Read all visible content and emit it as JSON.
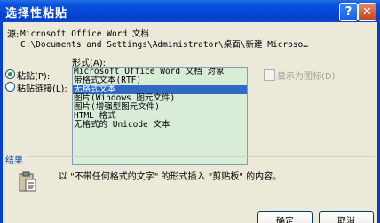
{
  "window": {
    "title": "选择性粘贴"
  },
  "source": {
    "label": "源:",
    "app": "Microsoft Office Word 文档",
    "path": "C:\\Documents and Settings\\Administrator\\桌面\\新建 Microso…"
  },
  "options": {
    "paste_label": "粘贴(P):",
    "paste_link_label": "粘贴链接(L):",
    "selected": "paste"
  },
  "format": {
    "label": "形式(A):",
    "items": [
      "Microsoft Office Word 文档 对象",
      "带格式文本(RTF)",
      "无格式文本",
      "图片(Windows 图元文件)",
      "图片(增强型图元文件)",
      "HTML 格式",
      "无格式的 Unicode 文本"
    ],
    "selected_index": 2
  },
  "display_as_icon": {
    "label": "显示为图标(D)",
    "checked": false
  },
  "result": {
    "label": "结果",
    "description": "以 \"不带任何格式的文字\" 的形式插入 \"剪贴板\" 的内容。"
  },
  "buttons": {
    "ok": "确定",
    "cancel": "取消"
  },
  "icons": {
    "help": "?",
    "close": "✕"
  },
  "colors": {
    "title_bar": "#0648d8",
    "selection": "#316ac5",
    "list_bg": "#d8ecd8"
  }
}
